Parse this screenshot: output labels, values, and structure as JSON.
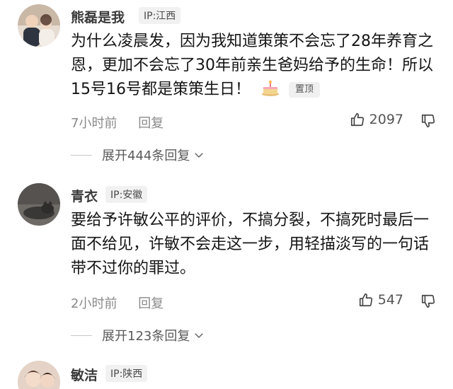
{
  "comments": [
    {
      "author": "熊磊是我",
      "ip": "IP:江西",
      "text": "为什么凌晨发，因为我知道策策不会忘了28年养育之恩，更加不会忘了30年前亲生爸妈给予的生命！所以15号16号都是策策生日！",
      "pinned_label": "置顶",
      "time": "7小时前",
      "reply_label": "回复",
      "likes": "2097",
      "expand_label": "展开444条回复"
    },
    {
      "author": "青衣",
      "ip": "IP:安徽",
      "text": "要给予许敏公平的评价，不搞分裂，不搞死时最后一面不给见，许敏不会走这一步，用轻描淡写的一句话带不过你的罪过。",
      "time": "2小时前",
      "reply_label": "回复",
      "likes": "547",
      "expand_label": "展开123条回复"
    },
    {
      "author": "敏洁",
      "ip": "IP:陕西"
    }
  ]
}
